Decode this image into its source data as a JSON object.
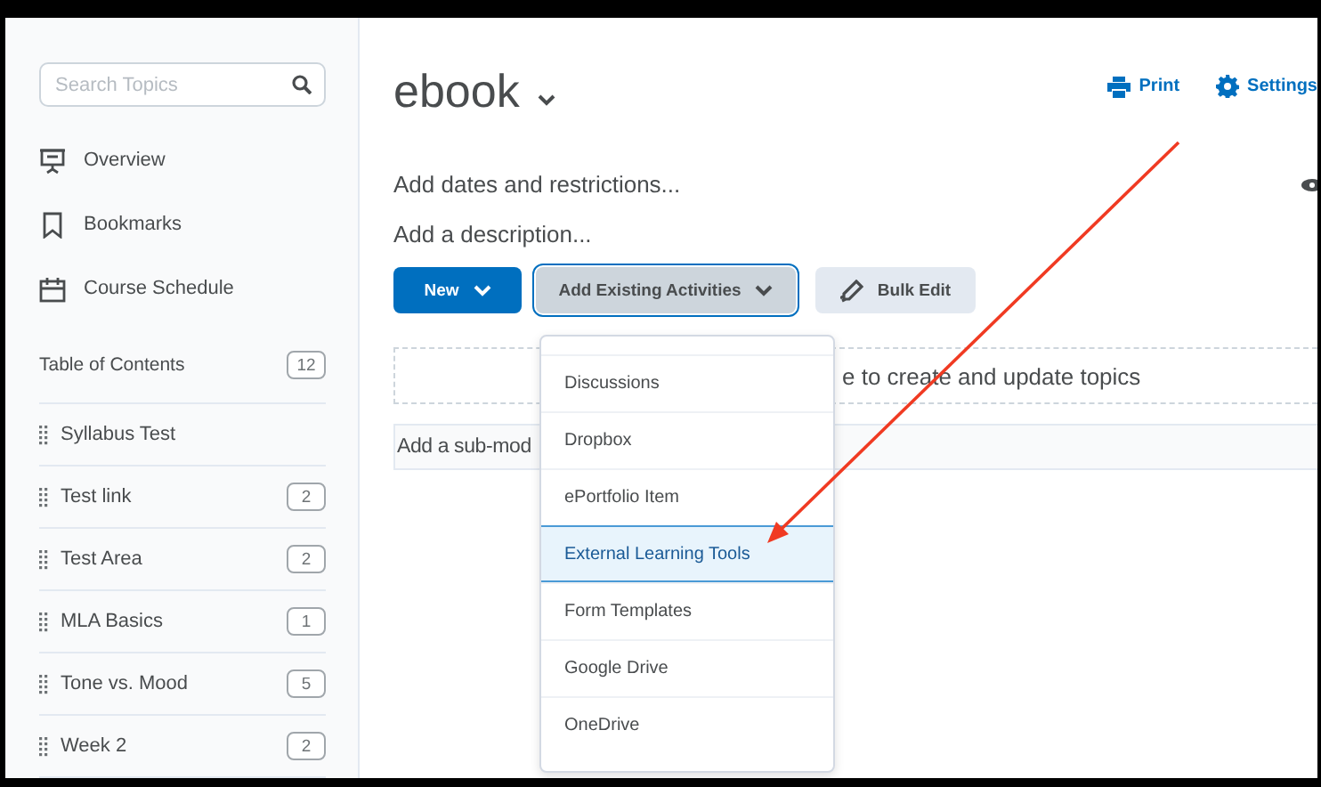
{
  "sidebar": {
    "search": {
      "placeholder": "Search Topics"
    },
    "nav": [
      {
        "label": "Overview",
        "kind": "overview"
      },
      {
        "label": "Bookmarks",
        "kind": "bookmarks"
      },
      {
        "label": "Course Schedule",
        "kind": "schedule"
      }
    ],
    "toc": {
      "label": "Table of Contents",
      "count": "12",
      "items": [
        {
          "title": "Syllabus Test"
        },
        {
          "title": "Test link",
          "count": "2"
        },
        {
          "title": "Test Area",
          "count": "2"
        },
        {
          "title": "MLA Basics",
          "count": "1"
        },
        {
          "title": "Tone vs. Mood",
          "count": "5"
        },
        {
          "title": "Week 2",
          "count": "2"
        }
      ]
    }
  },
  "main": {
    "title": "ebook",
    "actions": [
      {
        "label": "Print",
        "kind": "print"
      },
      {
        "label": "Settings",
        "kind": "settings"
      }
    ],
    "links": [
      "Add dates and restrictions...",
      "Add a description..."
    ],
    "buttons": [
      {
        "label": "New",
        "kind": "primary"
      },
      {
        "label": "Add Existing Activities",
        "kind": "dropdown"
      },
      {
        "label": "Bulk Edit",
        "kind": "bulk"
      }
    ],
    "drop_hint": "e to create and update topics",
    "submodule": {
      "placeholder": "Add a sub-mod"
    },
    "menu": {
      "items": [
        {
          "label": "Discussions",
          "selected": false
        },
        {
          "label": "Dropbox",
          "selected": false
        },
        {
          "label": "ePortfolio Item",
          "selected": false
        },
        {
          "label": "External Learning Tools",
          "selected": true
        },
        {
          "label": "Form Templates",
          "selected": false
        },
        {
          "label": "Google Drive",
          "selected": false
        },
        {
          "label": "OneDrive",
          "selected": false
        }
      ]
    }
  }
}
